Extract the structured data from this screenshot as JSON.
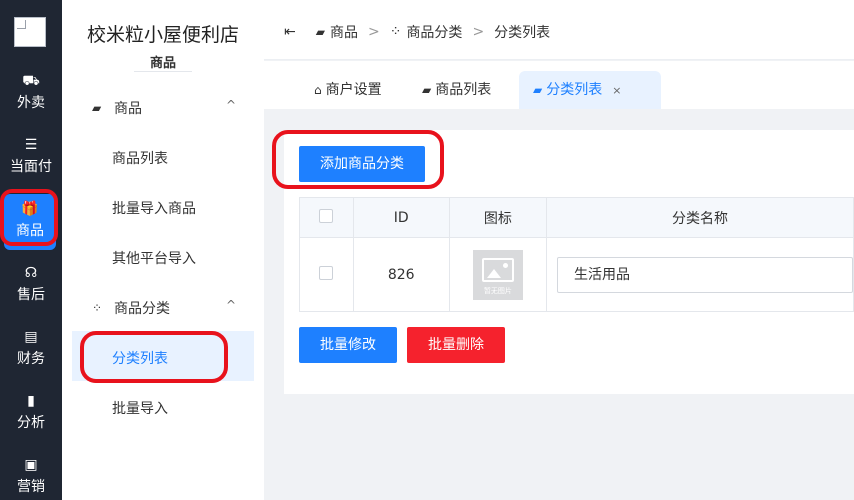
{
  "leftnav": {
    "items": [
      {
        "icon": "scooter-icon",
        "glyph": "⛟",
        "label": "外卖"
      },
      {
        "icon": "list-icon",
        "glyph": "☰",
        "label": "当面付"
      },
      {
        "icon": "gift-icon",
        "glyph": "🎁",
        "label": "商品"
      },
      {
        "icon": "headset-icon",
        "glyph": "☊",
        "label": "售后"
      },
      {
        "icon": "finance-icon",
        "glyph": "▤",
        "label": "财务"
      },
      {
        "icon": "bar-chart-icon",
        "glyph": "▮",
        "label": "分析"
      },
      {
        "icon": "gift-box-icon",
        "glyph": "▣",
        "label": "营销"
      }
    ],
    "active_index": 2
  },
  "sidebar": {
    "store_name": "校米粒小屋便利店",
    "section_title": "商品",
    "groups": [
      {
        "label": "商品",
        "icon": "gift-icon",
        "arrow": "^",
        "items": [
          "商品列表",
          "批量导入商品",
          "其他平台导入"
        ]
      },
      {
        "label": "商品分类",
        "icon": "grid-icon",
        "arrow": "^",
        "items": [
          "分类列表",
          "批量导入"
        ]
      }
    ],
    "active_item": "分类列表"
  },
  "breadcrumb": {
    "collapse_icon": "menu-fold-icon",
    "items": [
      "商品",
      "商品分类",
      "分类列表"
    ],
    "separator": ">"
  },
  "tabs": [
    {
      "label": "商户设置",
      "icon": "store-icon",
      "active": false
    },
    {
      "label": "商品列表",
      "icon": "gift-icon",
      "active": false
    },
    {
      "label": "分类列表",
      "icon": "gift-icon",
      "active": true,
      "close": "×"
    }
  ],
  "toolbar": {
    "add_button": "添加商品分类"
  },
  "table": {
    "columns": [
      "",
      "ID",
      "图标",
      "分类名称"
    ],
    "rows": [
      {
        "id": "826",
        "icon_caption": "暂无图片",
        "name": "生活用品"
      }
    ]
  },
  "actions": {
    "batch_edit": "批量修改",
    "batch_delete": "批量删除"
  },
  "colors": {
    "primary": "#1e80ff",
    "danger": "#f5222d",
    "annotation": "#e8121c",
    "nav_bg": "#1f2633"
  }
}
